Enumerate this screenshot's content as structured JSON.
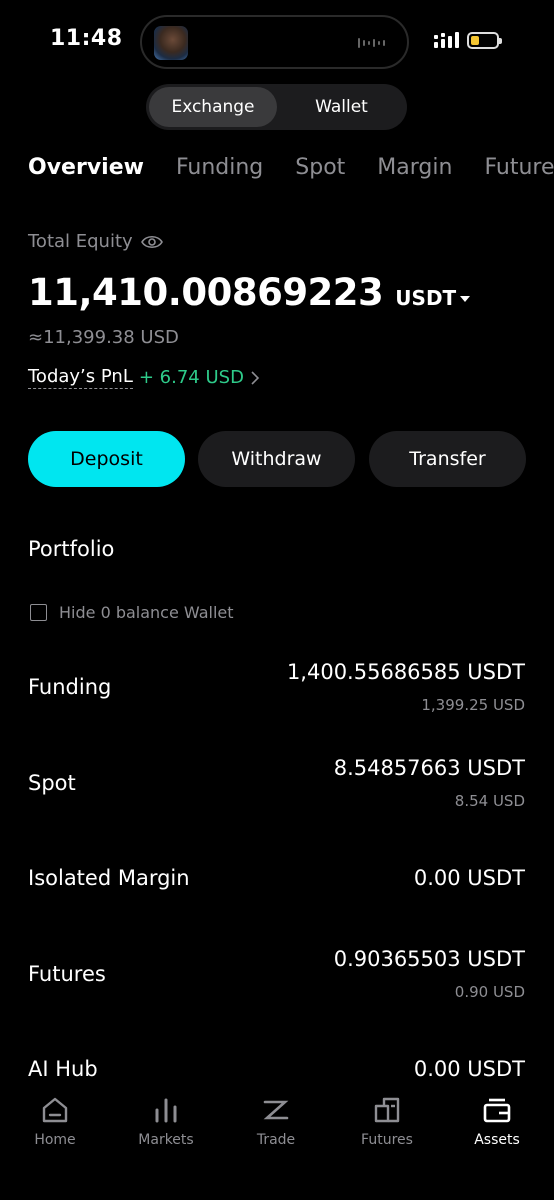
{
  "status_bar": {
    "time": "11:48"
  },
  "segmented": {
    "exchange": "Exchange",
    "wallet": "Wallet"
  },
  "tabs": [
    "Overview",
    "Funding",
    "Spot",
    "Margin",
    "Futures"
  ],
  "equity": {
    "label": "Total Equity",
    "value": "11,410.00869223",
    "unit": "USDT",
    "usd": "≈11,399.38 USD",
    "pnl_label": "Today’s PnL",
    "pnl_value": "+ 6.74 USD",
    "pnl_color": "#2ecb8a"
  },
  "actions": {
    "deposit": "Deposit",
    "withdraw": "Withdraw",
    "transfer": "Transfer",
    "accent": "#00e6f0"
  },
  "portfolio": {
    "title": "Portfolio",
    "hide_zero_label": "Hide 0 balance Wallet",
    "rows": [
      {
        "name": "Funding",
        "amount": "1,400.55686585 USDT",
        "usd": "1,399.25 USD"
      },
      {
        "name": "Spot",
        "amount": "8.54857663 USDT",
        "usd": "8.54 USD"
      },
      {
        "name": "Isolated Margin",
        "amount": "0.00 USDT",
        "usd": ""
      },
      {
        "name": "Futures",
        "amount": "0.90365503 USDT",
        "usd": "0.90 USD"
      },
      {
        "name": "AI Hub",
        "amount": "0.00 USDT",
        "usd": ""
      }
    ]
  },
  "bottom_nav": [
    {
      "label": "Home",
      "icon": "home-icon"
    },
    {
      "label": "Markets",
      "icon": "markets-icon"
    },
    {
      "label": "Trade",
      "icon": "trade-icon"
    },
    {
      "label": "Futures",
      "icon": "futures-icon"
    },
    {
      "label": "Assets",
      "icon": "wallet-icon",
      "active": true
    }
  ]
}
